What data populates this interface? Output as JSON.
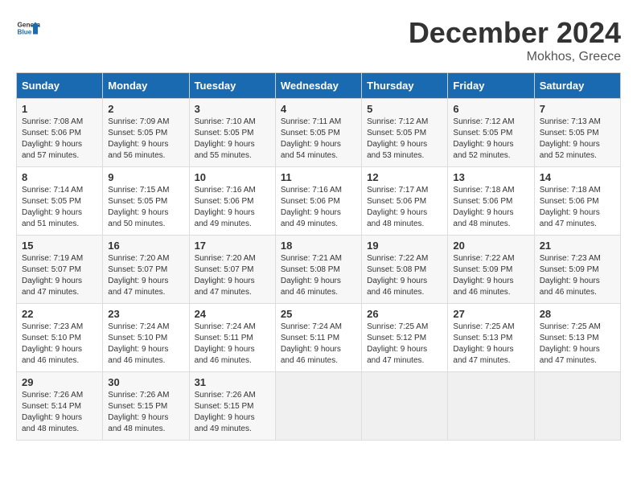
{
  "header": {
    "logo_general": "General",
    "logo_blue": "Blue",
    "title": "December 2024",
    "location": "Mokhos, Greece"
  },
  "weekdays": [
    "Sunday",
    "Monday",
    "Tuesday",
    "Wednesday",
    "Thursday",
    "Friday",
    "Saturday"
  ],
  "weeks": [
    [
      {
        "day": "1",
        "sunrise": "Sunrise: 7:08 AM",
        "sunset": "Sunset: 5:06 PM",
        "daylight": "Daylight: 9 hours and 57 minutes."
      },
      {
        "day": "2",
        "sunrise": "Sunrise: 7:09 AM",
        "sunset": "Sunset: 5:05 PM",
        "daylight": "Daylight: 9 hours and 56 minutes."
      },
      {
        "day": "3",
        "sunrise": "Sunrise: 7:10 AM",
        "sunset": "Sunset: 5:05 PM",
        "daylight": "Daylight: 9 hours and 55 minutes."
      },
      {
        "day": "4",
        "sunrise": "Sunrise: 7:11 AM",
        "sunset": "Sunset: 5:05 PM",
        "daylight": "Daylight: 9 hours and 54 minutes."
      },
      {
        "day": "5",
        "sunrise": "Sunrise: 7:12 AM",
        "sunset": "Sunset: 5:05 PM",
        "daylight": "Daylight: 9 hours and 53 minutes."
      },
      {
        "day": "6",
        "sunrise": "Sunrise: 7:12 AM",
        "sunset": "Sunset: 5:05 PM",
        "daylight": "Daylight: 9 hours and 52 minutes."
      },
      {
        "day": "7",
        "sunrise": "Sunrise: 7:13 AM",
        "sunset": "Sunset: 5:05 PM",
        "daylight": "Daylight: 9 hours and 52 minutes."
      }
    ],
    [
      {
        "day": "8",
        "sunrise": "Sunrise: 7:14 AM",
        "sunset": "Sunset: 5:05 PM",
        "daylight": "Daylight: 9 hours and 51 minutes."
      },
      {
        "day": "9",
        "sunrise": "Sunrise: 7:15 AM",
        "sunset": "Sunset: 5:05 PM",
        "daylight": "Daylight: 9 hours and 50 minutes."
      },
      {
        "day": "10",
        "sunrise": "Sunrise: 7:16 AM",
        "sunset": "Sunset: 5:06 PM",
        "daylight": "Daylight: 9 hours and 49 minutes."
      },
      {
        "day": "11",
        "sunrise": "Sunrise: 7:16 AM",
        "sunset": "Sunset: 5:06 PM",
        "daylight": "Daylight: 9 hours and 49 minutes."
      },
      {
        "day": "12",
        "sunrise": "Sunrise: 7:17 AM",
        "sunset": "Sunset: 5:06 PM",
        "daylight": "Daylight: 9 hours and 48 minutes."
      },
      {
        "day": "13",
        "sunrise": "Sunrise: 7:18 AM",
        "sunset": "Sunset: 5:06 PM",
        "daylight": "Daylight: 9 hours and 48 minutes."
      },
      {
        "day": "14",
        "sunrise": "Sunrise: 7:18 AM",
        "sunset": "Sunset: 5:06 PM",
        "daylight": "Daylight: 9 hours and 47 minutes."
      }
    ],
    [
      {
        "day": "15",
        "sunrise": "Sunrise: 7:19 AM",
        "sunset": "Sunset: 5:07 PM",
        "daylight": "Daylight: 9 hours and 47 minutes."
      },
      {
        "day": "16",
        "sunrise": "Sunrise: 7:20 AM",
        "sunset": "Sunset: 5:07 PM",
        "daylight": "Daylight: 9 hours and 47 minutes."
      },
      {
        "day": "17",
        "sunrise": "Sunrise: 7:20 AM",
        "sunset": "Sunset: 5:07 PM",
        "daylight": "Daylight: 9 hours and 47 minutes."
      },
      {
        "day": "18",
        "sunrise": "Sunrise: 7:21 AM",
        "sunset": "Sunset: 5:08 PM",
        "daylight": "Daylight: 9 hours and 46 minutes."
      },
      {
        "day": "19",
        "sunrise": "Sunrise: 7:22 AM",
        "sunset": "Sunset: 5:08 PM",
        "daylight": "Daylight: 9 hours and 46 minutes."
      },
      {
        "day": "20",
        "sunrise": "Sunrise: 7:22 AM",
        "sunset": "Sunset: 5:09 PM",
        "daylight": "Daylight: 9 hours and 46 minutes."
      },
      {
        "day": "21",
        "sunrise": "Sunrise: 7:23 AM",
        "sunset": "Sunset: 5:09 PM",
        "daylight": "Daylight: 9 hours and 46 minutes."
      }
    ],
    [
      {
        "day": "22",
        "sunrise": "Sunrise: 7:23 AM",
        "sunset": "Sunset: 5:10 PM",
        "daylight": "Daylight: 9 hours and 46 minutes."
      },
      {
        "day": "23",
        "sunrise": "Sunrise: 7:24 AM",
        "sunset": "Sunset: 5:10 PM",
        "daylight": "Daylight: 9 hours and 46 minutes."
      },
      {
        "day": "24",
        "sunrise": "Sunrise: 7:24 AM",
        "sunset": "Sunset: 5:11 PM",
        "daylight": "Daylight: 9 hours and 46 minutes."
      },
      {
        "day": "25",
        "sunrise": "Sunrise: 7:24 AM",
        "sunset": "Sunset: 5:11 PM",
        "daylight": "Daylight: 9 hours and 46 minutes."
      },
      {
        "day": "26",
        "sunrise": "Sunrise: 7:25 AM",
        "sunset": "Sunset: 5:12 PM",
        "daylight": "Daylight: 9 hours and 47 minutes."
      },
      {
        "day": "27",
        "sunrise": "Sunrise: 7:25 AM",
        "sunset": "Sunset: 5:13 PM",
        "daylight": "Daylight: 9 hours and 47 minutes."
      },
      {
        "day": "28",
        "sunrise": "Sunrise: 7:25 AM",
        "sunset": "Sunset: 5:13 PM",
        "daylight": "Daylight: 9 hours and 47 minutes."
      }
    ],
    [
      {
        "day": "29",
        "sunrise": "Sunrise: 7:26 AM",
        "sunset": "Sunset: 5:14 PM",
        "daylight": "Daylight: 9 hours and 48 minutes."
      },
      {
        "day": "30",
        "sunrise": "Sunrise: 7:26 AM",
        "sunset": "Sunset: 5:15 PM",
        "daylight": "Daylight: 9 hours and 48 minutes."
      },
      {
        "day": "31",
        "sunrise": "Sunrise: 7:26 AM",
        "sunset": "Sunset: 5:15 PM",
        "daylight": "Daylight: 9 hours and 49 minutes."
      },
      null,
      null,
      null,
      null
    ]
  ]
}
